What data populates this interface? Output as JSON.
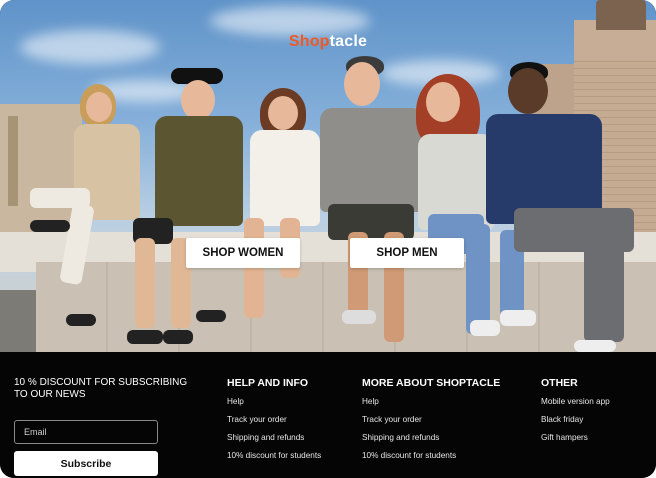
{
  "hero": {
    "logo_part1": "Shop",
    "logo_part2": "tacle",
    "shop_women": "SHOP WOMEN",
    "shop_men": "SHOP MEN",
    "colors": {
      "logo_accent": "#ee5a24",
      "logo_text": "#ffffff"
    }
  },
  "footer": {
    "promo_text": "10 % DISCOUNT FOR SUBSCRIBING TO OUR NEWS",
    "email_placeholder": "Email",
    "subscribe_label": "Subscribe",
    "columns": [
      {
        "title": "HELP AND INFO",
        "links": [
          "Help",
          "Track your order",
          "Shipping and refunds",
          "10% discount for students"
        ]
      },
      {
        "title": "MORE ABOUT SHOPTACLE",
        "links": [
          "Help",
          "Track your order",
          "Shipping and refunds",
          "10% discount for students"
        ]
      },
      {
        "title": "OTHER",
        "links": [
          "Mobile version app",
          "Black friday",
          "Gift hampers"
        ]
      }
    ]
  }
}
